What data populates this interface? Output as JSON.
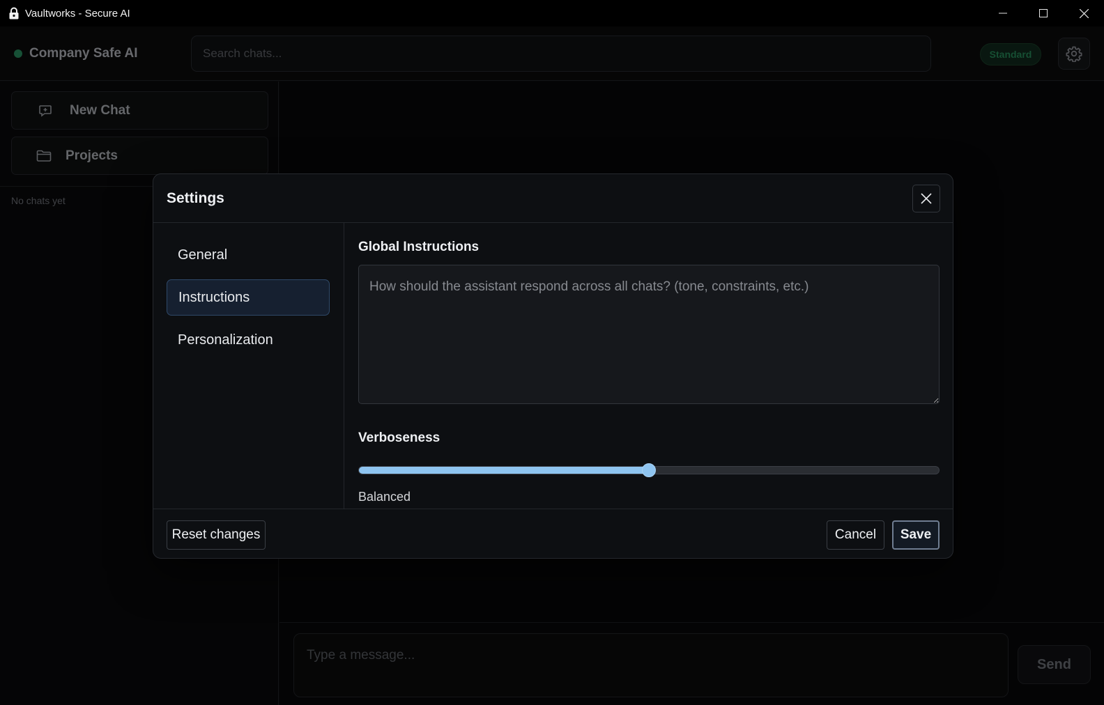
{
  "window": {
    "title": "Vaultworks - Secure AI",
    "icon": "lock-icon"
  },
  "header": {
    "brand": "Company Safe AI",
    "brand_status_color": "#1f6b48",
    "search_placeholder": "Search chats...",
    "plan_badge": "Standard",
    "settings_icon": "gear-icon"
  },
  "sidebar": {
    "new_chat_label": "New Chat",
    "projects_label": "Projects",
    "empty_state": "No chats yet"
  },
  "composer": {
    "placeholder": "Type a message...",
    "send_label": "Send"
  },
  "settings_modal": {
    "title": "Settings",
    "nav": [
      {
        "label": "General",
        "active": false
      },
      {
        "label": "Instructions",
        "active": true
      },
      {
        "label": "Personalization",
        "active": false
      }
    ],
    "instructions": {
      "label": "Global Instructions",
      "placeholder": "How should the assistant respond across all chats? (tone, constraints, etc.)",
      "value": ""
    },
    "verboseness": {
      "label": "Verboseness",
      "value_fraction": 0.5,
      "value_label": "Balanced"
    },
    "footer": {
      "reset_label": "Reset changes",
      "cancel_label": "Cancel",
      "save_label": "Save"
    }
  },
  "colors": {
    "accent": "#8ec4f0",
    "active_nav_bg": "#162030",
    "badge_text": "#1e6a45"
  }
}
